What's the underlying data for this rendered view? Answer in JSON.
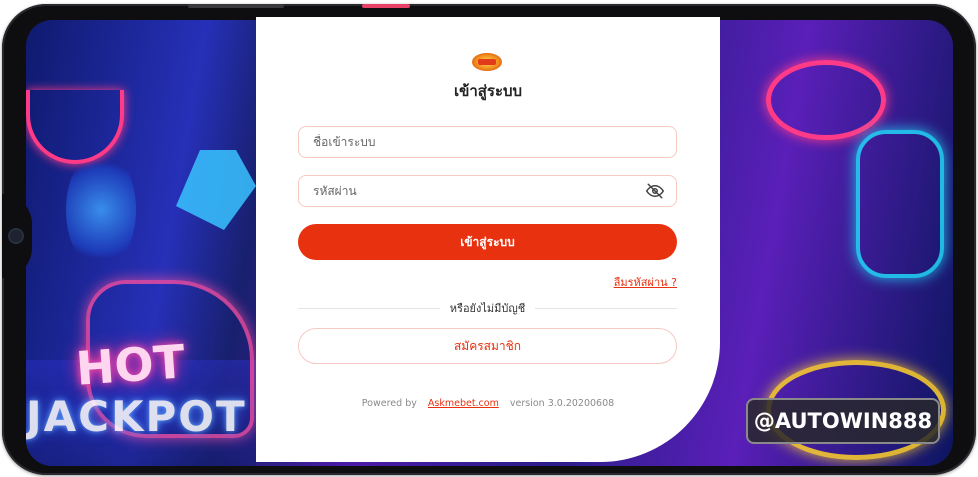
{
  "login": {
    "title": "เข้าสู่ระบบ",
    "username_placeholder": "ชื่อเข้าระบบ",
    "password_placeholder": "รหัสผ่าน",
    "login_button": "เข้าสู่ระบบ",
    "forgot_password": "ลืมรหัสผ่าน ?",
    "divider_text": "หรือยังไม่มีบัญชี",
    "register_button": "สมัครสมาชิก"
  },
  "footer": {
    "powered_by": "Powered by",
    "brand_link": "Askmebet.com",
    "version": "version 3.0.20200608"
  },
  "background": {
    "neon_hot": "HOT",
    "neon_jackpot": "JACKPOT"
  },
  "watermark": "@AUTOWIN888",
  "colors": {
    "accent": "#e8310f",
    "field_border": "#f6c9c3",
    "card_bg": "#ffffff"
  },
  "icons": {
    "password_toggle": "eye-slash-icon",
    "logo": "brand-logo"
  }
}
